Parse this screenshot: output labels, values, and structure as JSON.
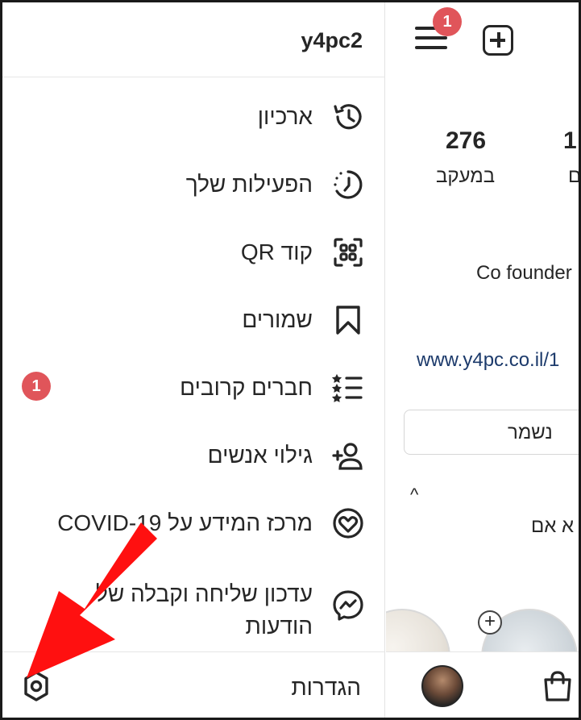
{
  "drawer": {
    "username": "y4pc2",
    "items": [
      {
        "label": "ארכיון",
        "icon": "archive-history-icon"
      },
      {
        "label": "הפעילות שלך",
        "icon": "activity-clock-icon"
      },
      {
        "label": "קוד QR",
        "icon": "qr-code-icon"
      },
      {
        "label": "שמורים",
        "icon": "bookmark-icon"
      },
      {
        "label": "חברים קרובים",
        "icon": "close-friends-list-icon",
        "badge": "1"
      },
      {
        "label": "גילוי אנשים",
        "icon": "add-person-icon"
      },
      {
        "label": "מרכז המידע על COVID-19",
        "icon": "covid-heart-icon"
      },
      {
        "label": "עדכון שליחה וקבלה של הודעות",
        "icon": "messenger-icon"
      }
    ],
    "settings_label": "הגדרות",
    "settings_icon": "gear-icon"
  },
  "profile": {
    "menu_badge": "1",
    "stats": [
      {
        "value": "276",
        "label": "במעקב"
      },
      {
        "value": "1",
        "label": "ם"
      }
    ],
    "bio": "Co founder",
    "link": "www.y4pc.co.il/1",
    "saved_button": "נשמר",
    "caret": "^",
    "partial_text": "א אם"
  },
  "colors": {
    "badge": "#e0555a",
    "arrow": "#ff1010",
    "link": "#1c3a6b"
  }
}
